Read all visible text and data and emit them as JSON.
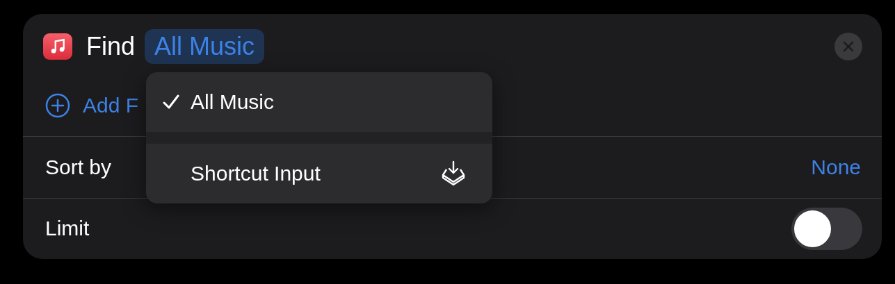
{
  "action": {
    "verb": "Find",
    "parameter": "All Music",
    "add_filter": "Add F"
  },
  "rows": [
    {
      "kind": "value",
      "label": "Sort by",
      "value": "None"
    },
    {
      "kind": "toggle",
      "label": "Limit",
      "on": false
    }
  ],
  "menu": {
    "items": [
      {
        "label": "All Music",
        "selected": true
      },
      {
        "label": "Shortcut Input",
        "selected": false
      }
    ]
  }
}
